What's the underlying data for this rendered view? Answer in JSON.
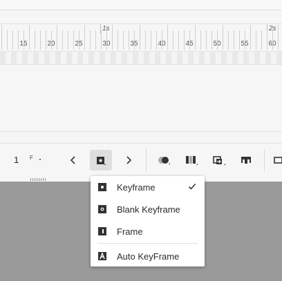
{
  "timeline": {
    "second_labels": [
      "1s",
      "2s"
    ],
    "frame_numbers": [
      "15",
      "20",
      "25",
      "30",
      "35",
      "40",
      "45",
      "50",
      "55",
      "60"
    ]
  },
  "toolbar": {
    "current_frame": "1",
    "frame_unit": "F"
  },
  "keyframe_menu": {
    "items": [
      {
        "label": "Keyframe",
        "icon": "keyframe-icon",
        "checked": true
      },
      {
        "label": "Blank Keyframe",
        "icon": "blank-keyframe-icon",
        "checked": false
      },
      {
        "label": "Frame",
        "icon": "frame-icon",
        "checked": false
      },
      {
        "label": "Auto KeyFrame",
        "icon": "auto-keyframe-icon",
        "checked": false
      }
    ]
  },
  "colors": {
    "panel_bg": "#f6f6f6",
    "stage_bg": "#9a9a9a",
    "menu_bg": "#ffffff",
    "icon": "#333333",
    "active_button": "#dedede"
  }
}
